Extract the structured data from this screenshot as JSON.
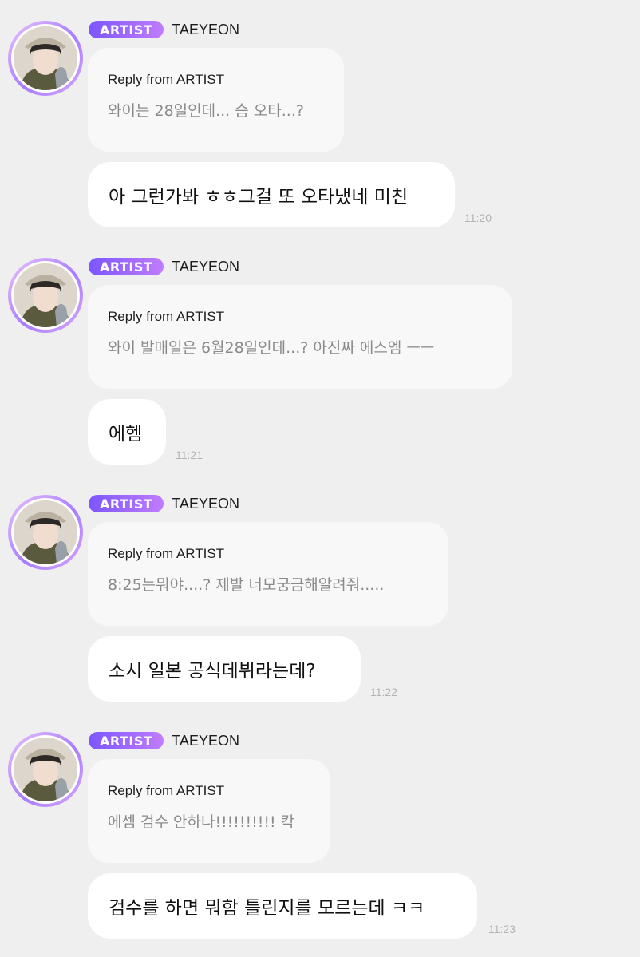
{
  "messages": [
    {
      "badge": "ARTIST",
      "artist": "TAEYEON",
      "reply_label": "Reply from ARTIST",
      "quoted": "와이는 28일인데... 슴 오타...?",
      "reply": "아 그런가봐 ㅎㅎ그걸 또 오타냈네 미친",
      "time": "11:20"
    },
    {
      "badge": "ARTIST",
      "artist": "TAEYEON",
      "reply_label": "Reply from ARTIST",
      "quoted": "와이 발매일은 6월28일인데...? 아진짜 에스엠 ㅡㅡ",
      "reply": "에헴",
      "time": "11:21"
    },
    {
      "badge": "ARTIST",
      "artist": "TAEYEON",
      "reply_label": "Reply from ARTIST",
      "quoted": "8:25는뭐야....? 제발 너모궁금해알려줘.....",
      "reply": "소시 일본 공식데뷔라는데?",
      "time": "11:22"
    },
    {
      "badge": "ARTIST",
      "artist": "TAEYEON",
      "reply_label": "Reply from ARTIST",
      "quoted": "에셈 검수 안하나!!!!!!!!!! 칵",
      "reply": "검수를 하면 뭐함 틀린지를 모르는데 ㅋㅋ",
      "time": "11:23"
    }
  ],
  "colors": {
    "background": "#efefef",
    "badge_gradient_start": "#7b56ff",
    "badge_gradient_end": "#c07cff",
    "quote_bubble": "#f8f8f8",
    "reply_bubble": "#ffffff"
  },
  "icons": [
    "artist-avatar"
  ]
}
